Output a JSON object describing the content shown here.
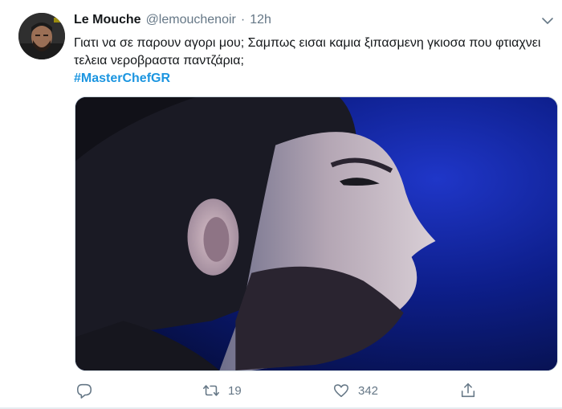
{
  "tweet": {
    "display_name": "Le Mouche",
    "handle": "@lemouchenoir",
    "separator": "·",
    "time": "12h",
    "text": "Γιατι να σε παρουν αγορι μου; Σαμπως εισαι καμια ξιπασμενη γκιοσα που φτιαχνει τελεια νεροβραστα παντζάρια;",
    "hashtag": "#MasterChefGR",
    "retweet_count": "19",
    "like_count": "342"
  },
  "icons": {
    "reply": "reply-icon",
    "retweet": "retweet-icon",
    "like": "heart-icon",
    "share": "share-icon",
    "more": "chevron-down-icon"
  },
  "colors": {
    "text": "#14171a",
    "secondary": "#657786",
    "hashtag": "#1b95e0",
    "border": "#e6ecf0"
  }
}
